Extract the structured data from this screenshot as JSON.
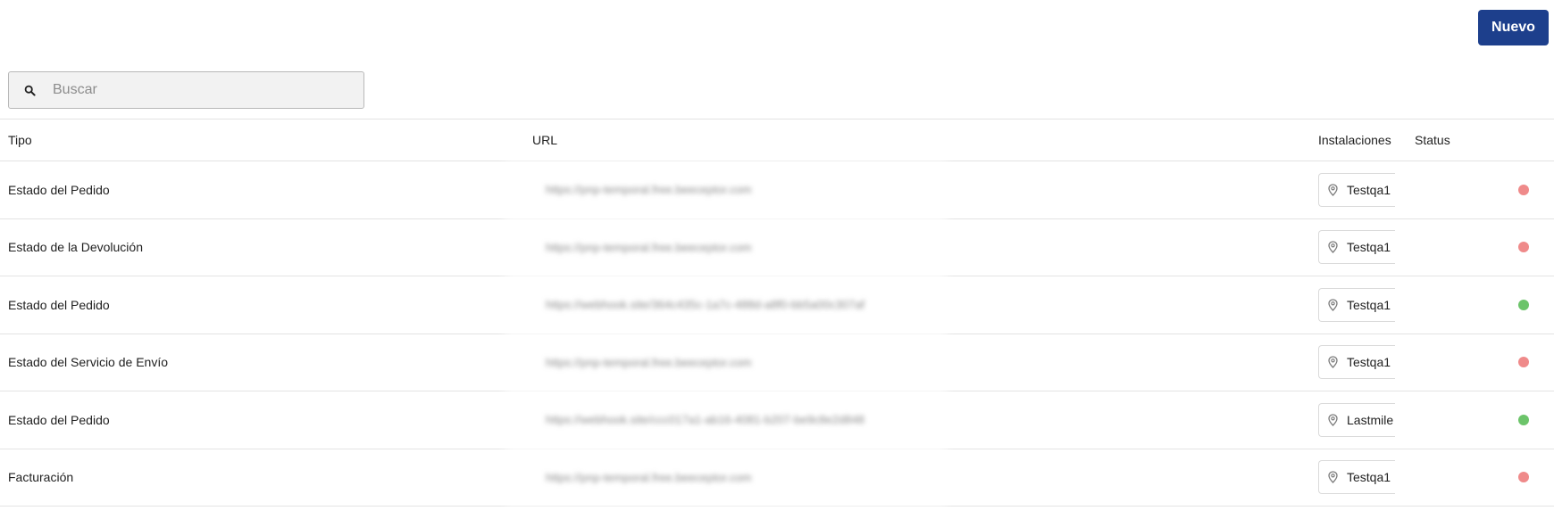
{
  "toolbar": {
    "new_label": "Nuevo"
  },
  "search": {
    "placeholder": "Buscar",
    "value": ""
  },
  "table": {
    "headers": {
      "tipo": "Tipo",
      "url": "URL",
      "instalaciones": "Instalaciones",
      "status": "Status"
    },
    "rows": [
      {
        "tipo": "Estado del Pedido",
        "url": "https://pnp-temporal.free.beeceptor.com",
        "instalacion": "Testqa1",
        "status": "inactive",
        "status_color": "#ef8a8a"
      },
      {
        "tipo": "Estado de la Devolución",
        "url": "https://pnp-temporal.free.beeceptor.com",
        "instalacion": "Testqa1",
        "status": "inactive",
        "status_color": "#ef8a8a"
      },
      {
        "tipo": "Estado del Pedido",
        "url": "https://webhook.site/364c435c-1a7c-488d-a8f0-bb5a00c307af",
        "instalacion": "Testqa1",
        "status": "active",
        "status_color": "#6cc46a"
      },
      {
        "tipo": "Estado del Servicio de Envío",
        "url": "https://pnp-temporal.free.beeceptor.com",
        "instalacion": "Testqa1",
        "status": "inactive",
        "status_color": "#ef8a8a"
      },
      {
        "tipo": "Estado del Pedido",
        "url": "https://webhook.site/ccc017a1-ab16-4081-b207-be9c8e2d848",
        "instalacion": "Lastmile",
        "status": "active",
        "status_color": "#6cc46a"
      },
      {
        "tipo": "Facturación",
        "url": "https://pnp-temporal.free.beeceptor.com",
        "instalacion": "Testqa1",
        "status": "inactive",
        "status_color": "#ef8a8a"
      }
    ]
  },
  "icons": {
    "search": "search-icon",
    "location": "location-pin-icon"
  },
  "colors": {
    "primary": "#1d3f8c",
    "status_active": "#6cc46a",
    "status_inactive": "#ef8a8a"
  }
}
